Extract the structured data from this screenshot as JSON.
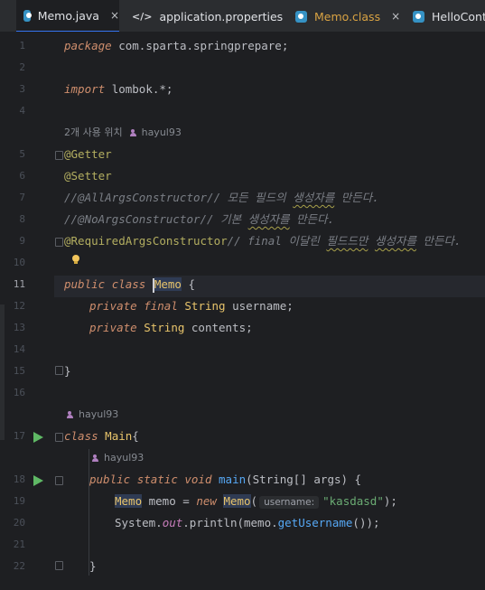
{
  "tabs": [
    {
      "label": "Memo.java",
      "close": "×",
      "state": "active"
    },
    {
      "label": "application.properties",
      "icon_text": "</>",
      "close": "×",
      "state": "normal"
    },
    {
      "label": "Memo.class",
      "close": "×",
      "state": "modified"
    },
    {
      "label": "HelloContro",
      "close": "",
      "state": "normal"
    }
  ],
  "line_numbers": [
    "1",
    "2",
    "3",
    "4",
    "",
    "5",
    "6",
    "7",
    "8",
    "9",
    "10",
    "11",
    "12",
    "13",
    "14",
    "15",
    "16",
    "",
    "17",
    "",
    "18",
    "19",
    "20",
    "21",
    "22"
  ],
  "code": {
    "l1": {
      "kw": "package",
      "name": "com.sparta.springprepare",
      "end": ";"
    },
    "l3": {
      "kw": "import",
      "name": "lombok.*",
      "end": ";"
    },
    "usage_hint": {
      "count": "2개 사용 위치",
      "author": "hayul93"
    },
    "l5": "@Getter",
    "l6": "@Setter",
    "l7": {
      "code": "//@AllArgsConstructor",
      "c1": "// 모든 필드의 ",
      "c2": "생성자를",
      "c3": " 만든다."
    },
    "l8": {
      "code": "//@NoArgsConstructor",
      "c1": "// 기본 ",
      "c2": "생성자를",
      "c3": " 만든다."
    },
    "l9": {
      "ann": "@RequiredArgsConstructor",
      "c1": "// final 이달린 ",
      "c2": "필드드만",
      "c3": " ",
      "c4": "생성자를",
      "c5": " 만든다."
    },
    "l11": {
      "kw1": "public",
      "kw2": "class",
      "name": "Memo",
      "brace": " {"
    },
    "l12": {
      "kw1": "private",
      "kw2": "final",
      "type": "String",
      "field": "username",
      "end": ";"
    },
    "l13": {
      "kw1": "private",
      "type": "String",
      "field": "contents",
      "end": ";"
    },
    "l15": "}",
    "author_hint": "hayul93",
    "l17": {
      "kw": "class",
      "name": "Main",
      "brace": "{"
    },
    "author_hint2": "hayul93",
    "l18": {
      "kw1": "public",
      "kw2": "static",
      "kw3": "void",
      "method": "main",
      "params_a": "(String[] ",
      "param": "args",
      "params_b": ") {"
    },
    "l19": {
      "type": "Memo",
      "var": " memo = ",
      "kw": "new",
      "cls": "Memo",
      "open": "(",
      "inlay": "username:",
      "str": "\"kasdasd\"",
      "end": ");"
    },
    "l20": {
      "a": "System.",
      "out": "out",
      "b": ".println(memo.",
      "getter": "getUsername",
      "c": "());"
    },
    "l22": "}"
  },
  "colors": {
    "background": "#1e1f22",
    "tabbar": "#2b2d30",
    "active_tab_underline": "#3574f0",
    "keyword": "#cf8e6d",
    "annotation": "#b3ae60",
    "comment": "#7a7e85",
    "class": "#e8c46b",
    "field": "#c77dbb",
    "method": "#56a8f5",
    "string": "#6aab73",
    "run_icon": "#5fb865"
  },
  "icons": [
    "java-file-icon",
    "properties-file-icon",
    "run-gutter-icon",
    "fold-icon",
    "lightbulb-icon",
    "author-icon"
  ]
}
